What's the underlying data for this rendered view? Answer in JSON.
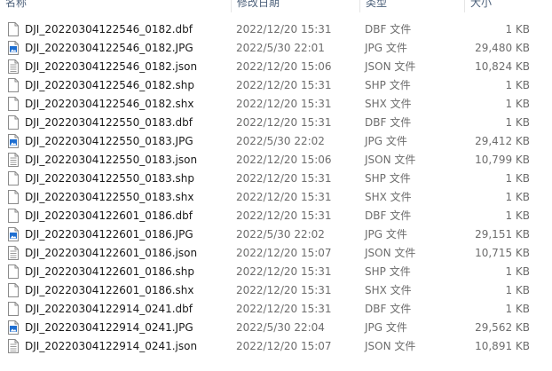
{
  "columns": {
    "name": "名称",
    "date": "修改日期",
    "type": "类型",
    "size": "大小"
  },
  "files": [
    {
      "name": "DJI_20220304122546_0182.dbf",
      "date": "2022/12/20 15:31",
      "type": "DBF 文件",
      "size": "1 KB",
      "icon": "blank-file-icon"
    },
    {
      "name": "DJI_20220304122546_0182.JPG",
      "date": "2022/5/30 22:01",
      "type": "JPG 文件",
      "size": "29,480 KB",
      "icon": "image-file-icon"
    },
    {
      "name": "DJI_20220304122546_0182.json",
      "date": "2022/12/20 15:06",
      "type": "JSON 文件",
      "size": "10,824 KB",
      "icon": "text-file-icon"
    },
    {
      "name": "DJI_20220304122546_0182.shp",
      "date": "2022/12/20 15:31",
      "type": "SHP 文件",
      "size": "1 KB",
      "icon": "blank-file-icon"
    },
    {
      "name": "DJI_20220304122546_0182.shx",
      "date": "2022/12/20 15:31",
      "type": "SHX 文件",
      "size": "1 KB",
      "icon": "blank-file-icon"
    },
    {
      "name": "DJI_20220304122550_0183.dbf",
      "date": "2022/12/20 15:31",
      "type": "DBF 文件",
      "size": "1 KB",
      "icon": "blank-file-icon"
    },
    {
      "name": "DJI_20220304122550_0183.JPG",
      "date": "2022/5/30 22:02",
      "type": "JPG 文件",
      "size": "29,412 KB",
      "icon": "image-file-icon"
    },
    {
      "name": "DJI_20220304122550_0183.json",
      "date": "2022/12/20 15:06",
      "type": "JSON 文件",
      "size": "10,799 KB",
      "icon": "text-file-icon"
    },
    {
      "name": "DJI_20220304122550_0183.shp",
      "date": "2022/12/20 15:31",
      "type": "SHP 文件",
      "size": "1 KB",
      "icon": "blank-file-icon"
    },
    {
      "name": "DJI_20220304122550_0183.shx",
      "date": "2022/12/20 15:31",
      "type": "SHX 文件",
      "size": "1 KB",
      "icon": "blank-file-icon"
    },
    {
      "name": "DJI_20220304122601_0186.dbf",
      "date": "2022/12/20 15:31",
      "type": "DBF 文件",
      "size": "1 KB",
      "icon": "blank-file-icon"
    },
    {
      "name": "DJI_20220304122601_0186.JPG",
      "date": "2022/5/30 22:02",
      "type": "JPG 文件",
      "size": "29,151 KB",
      "icon": "image-file-icon"
    },
    {
      "name": "DJI_20220304122601_0186.json",
      "date": "2022/12/20 15:07",
      "type": "JSON 文件",
      "size": "10,715 KB",
      "icon": "text-file-icon"
    },
    {
      "name": "DJI_20220304122601_0186.shp",
      "date": "2022/12/20 15:31",
      "type": "SHP 文件",
      "size": "1 KB",
      "icon": "blank-file-icon"
    },
    {
      "name": "DJI_20220304122601_0186.shx",
      "date": "2022/12/20 15:31",
      "type": "SHX 文件",
      "size": "1 KB",
      "icon": "blank-file-icon"
    },
    {
      "name": "DJI_20220304122914_0241.dbf",
      "date": "2022/12/20 15:31",
      "type": "DBF 文件",
      "size": "1 KB",
      "icon": "blank-file-icon"
    },
    {
      "name": "DJI_20220304122914_0241.JPG",
      "date": "2022/5/30 22:04",
      "type": "JPG 文件",
      "size": "29,562 KB",
      "icon": "image-file-icon"
    },
    {
      "name": "DJI_20220304122914_0241.json",
      "date": "2022/12/20 15:07",
      "type": "JSON 文件",
      "size": "10,891 KB",
      "icon": "text-file-icon"
    }
  ],
  "colors": {
    "header_text": "#4c607a",
    "detail_text": "#6d6d6d",
    "name_text": "#1a1a1a",
    "image_icon_accent": "#1f6fd1"
  }
}
